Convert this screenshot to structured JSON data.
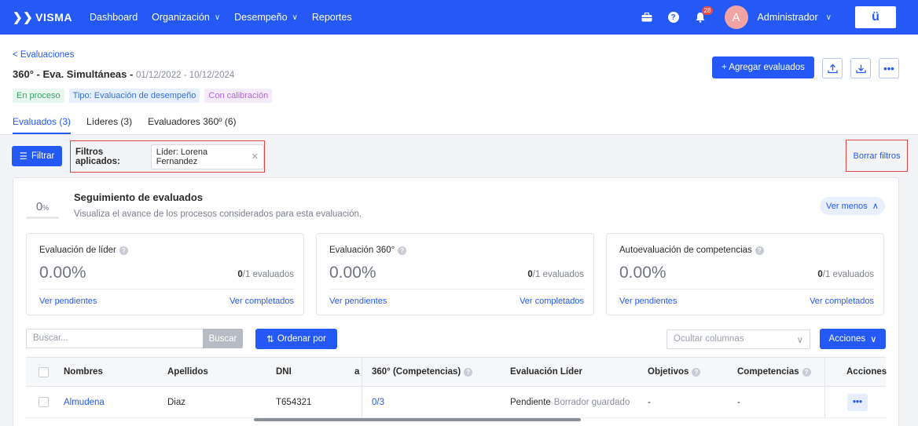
{
  "nav": {
    "logo": "VISMA",
    "items": [
      {
        "label": "Dashboard",
        "dropdown": false
      },
      {
        "label": "Organización",
        "dropdown": true
      },
      {
        "label": "Desempeño",
        "dropdown": true
      },
      {
        "label": "Reportes",
        "dropdown": false
      }
    ],
    "notifications": "28",
    "avatar_letter": "A",
    "user": "Administrador",
    "brand_mark": "ü"
  },
  "header": {
    "back": "< Evaluaciones",
    "title": "360° - Eva. Simultáneas - ",
    "dates": "01/12/2022 - 10/12/2024",
    "tags": [
      "En proceso",
      "Tipo: Evaluación de desempeño",
      "Con calibración"
    ],
    "tabs": [
      "Evaluados (3)",
      "Líderes (3)",
      "Evaluadores 360º (6)"
    ],
    "add_button": "+ Agregar evaluados"
  },
  "filters": {
    "filter_button": "Filtrar",
    "applied_label": "Filtros aplicados:",
    "chip": "Líder: Lorena Fernandez",
    "clear": "Borrar filtros"
  },
  "tracking": {
    "percent": "0",
    "percent_unit": "%",
    "title": "Seguimiento de evaluados",
    "subtitle": "Visualiza el avance de los procesos considerados para esta evaluación.",
    "toggle": "Ver menos"
  },
  "cards": [
    {
      "title": "Evaluación de líder",
      "value": "0.00%",
      "count_bold": "0",
      "count_rest": "/1 evaluados",
      "pending": "Ver pendientes",
      "completed": "Ver completados"
    },
    {
      "title": "Evaluación 360°",
      "value": "0.00%",
      "count_bold": "0",
      "count_rest": "/1 evaluados",
      "pending": "Ver pendientes",
      "completed": "Ver completados"
    },
    {
      "title": "Autoevaluación de competencias",
      "value": "0.00%",
      "count_bold": "0",
      "count_rest": "/1 evaluados",
      "pending": "Ver pendientes",
      "completed": "Ver completados"
    }
  ],
  "toolbar": {
    "search_placeholder": "Buscar...",
    "search_button": "Buscar",
    "sort_button": "Ordenar por",
    "columns_placeholder": "Ocultar columnas",
    "actions_button": "Acciones"
  },
  "table": {
    "headers": {
      "nombres": "Nombres",
      "apellidos": "Apellidos",
      "dni": "DNI",
      "cut": "a",
      "c360": "360° (Competencias)",
      "lider": "Evaluación Líder",
      "objetivos": "Objetivos",
      "competencias": "Competencias",
      "acciones": "Acciones"
    },
    "rows": [
      {
        "nombres": "Almudena",
        "apellidos": "Diaz",
        "dni": "T654321",
        "c360": "0/3",
        "lider_status": "Pendiente",
        "lider_note": "Borrador guardado",
        "objetivos": "-",
        "competencias": "-"
      }
    ]
  }
}
